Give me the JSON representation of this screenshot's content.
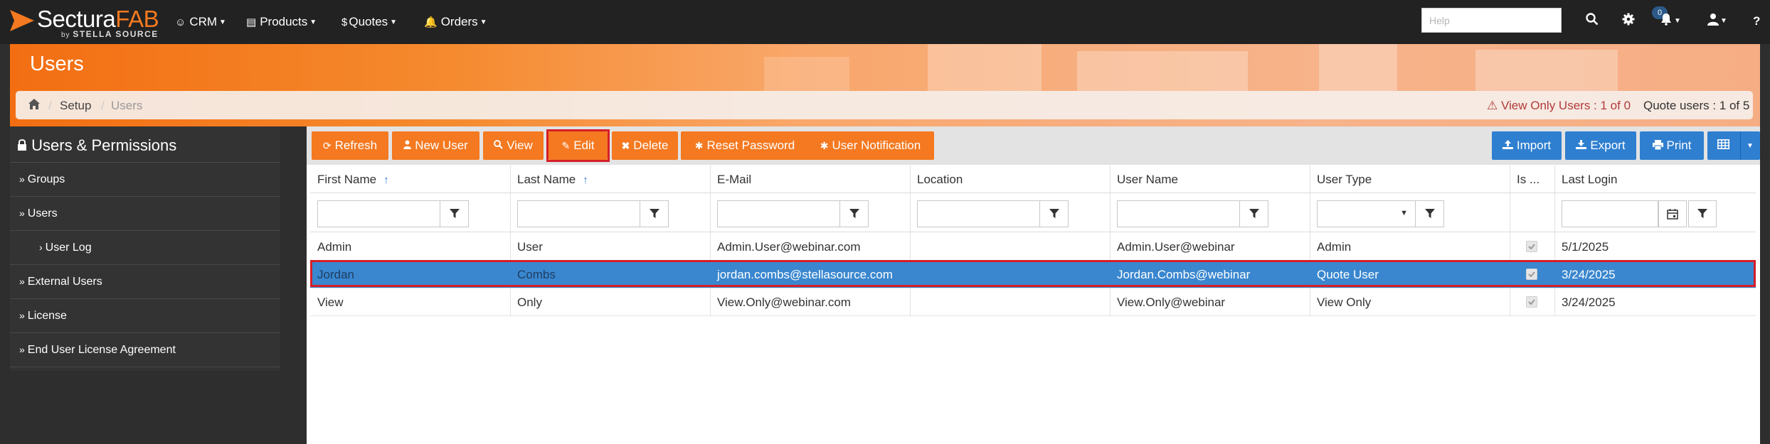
{
  "app": {
    "logo_main": "Sectura",
    "logo_accent": "FAB",
    "logo_by": "by",
    "logo_sub": "STELLA SOURCE"
  },
  "nav": {
    "menus": [
      "CRM",
      "Products",
      "Quotes",
      "Orders"
    ],
    "help_placeholder": "Help",
    "notification_count": "0"
  },
  "header": {
    "title": "Users",
    "breadcrumb": [
      "Setup",
      "Users"
    ],
    "view_only_users": "View Only Users : 1 of 0",
    "quote_users": "Quote users : 1 of 5"
  },
  "sidebar": {
    "title": "Users & Permissions",
    "items": [
      {
        "label": "Groups",
        "indent": false
      },
      {
        "label": "Users",
        "indent": false
      },
      {
        "label": "User Log",
        "indent": true
      },
      {
        "label": "External Users",
        "indent": false
      },
      {
        "label": "License",
        "indent": false
      },
      {
        "label": "End User License Agreement",
        "indent": false
      }
    ]
  },
  "toolbar": {
    "refresh": "Refresh",
    "new_user": "New User",
    "view": "View",
    "edit": "Edit",
    "delete": "Delete",
    "reset_password": "Reset Password",
    "user_notification": "User Notification",
    "import": "Import",
    "export": "Export",
    "print": "Print"
  },
  "table": {
    "columns": [
      "First Name",
      "Last Name",
      "E-Mail",
      "Location",
      "User Name",
      "User Type",
      "Is ...",
      "Last Login"
    ],
    "sorted_columns": [
      "First Name",
      "Last Name"
    ],
    "rows": [
      {
        "first": "Admin",
        "last": "User",
        "email": "Admin.User@webinar.com",
        "location": "",
        "username": "Admin.User@webinar",
        "type": "Admin",
        "checked": true,
        "last_login": "5/1/2025",
        "selected": false
      },
      {
        "first": "Jordan",
        "last": "Combs",
        "email": "jordan.combs@stellasource.com",
        "location": "",
        "username": "Jordan.Combs@webinar",
        "type": "Quote User",
        "checked": true,
        "last_login": "3/24/2025",
        "selected": true
      },
      {
        "first": "View",
        "last": "Only",
        "email": "View.Only@webinar.com",
        "location": "",
        "username": "View.Only@webinar",
        "type": "View Only",
        "checked": true,
        "last_login": "3/24/2025",
        "selected": false
      }
    ]
  },
  "colors": {
    "accent_orange": "#f47920",
    "button_blue": "#2f7fd0",
    "selection_blue": "#3a87cf",
    "highlight_red": "#d51f28"
  }
}
